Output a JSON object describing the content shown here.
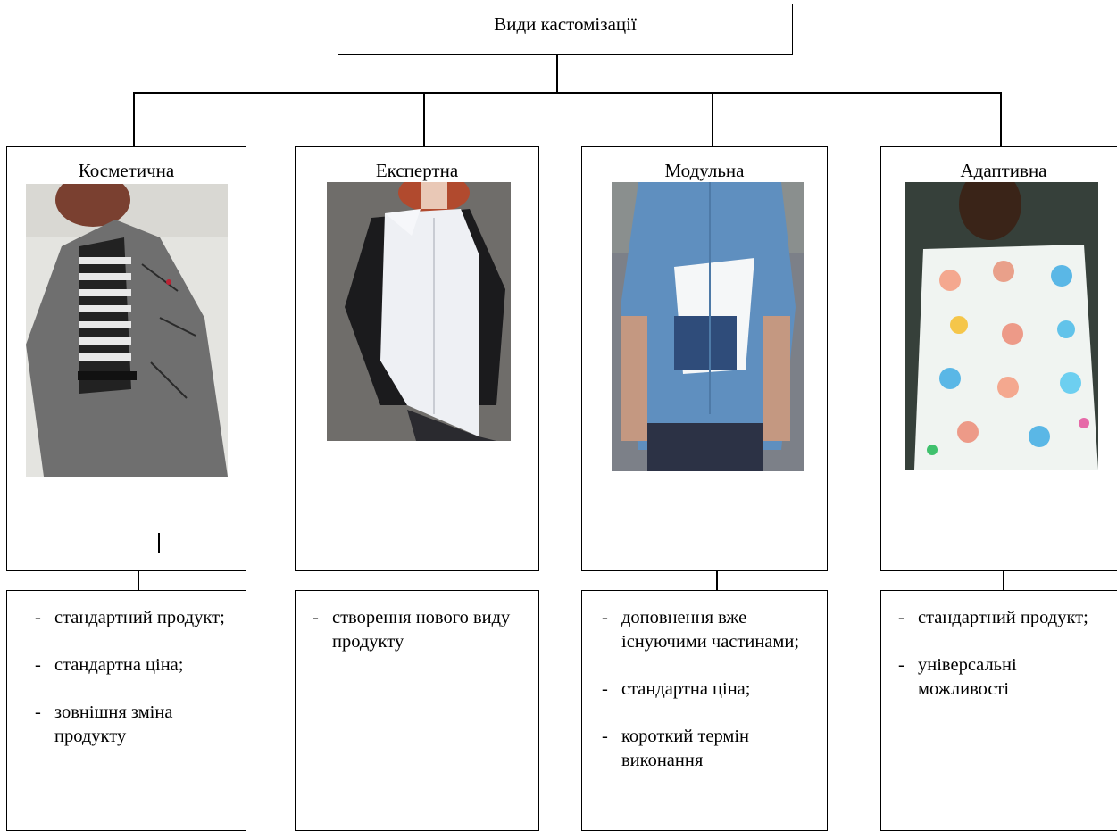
{
  "title": "Види кастомізації",
  "columns": [
    {
      "label": "Косметична",
      "items": [
        "стандартний продукт;",
        "стандартна ціна;",
        "зовнішня зміна продукту"
      ]
    },
    {
      "label": "Експертна",
      "items": [
        "створення нового виду продукту"
      ]
    },
    {
      "label": "Модульна",
      "items": [
        "доповнення вже існуючими частинами;",
        "стандартна ціна;",
        "короткий термін виконання"
      ]
    },
    {
      "label": "Адаптивна",
      "items": [
        "стандартний продукт;",
        "універсальні можливості"
      ]
    }
  ]
}
